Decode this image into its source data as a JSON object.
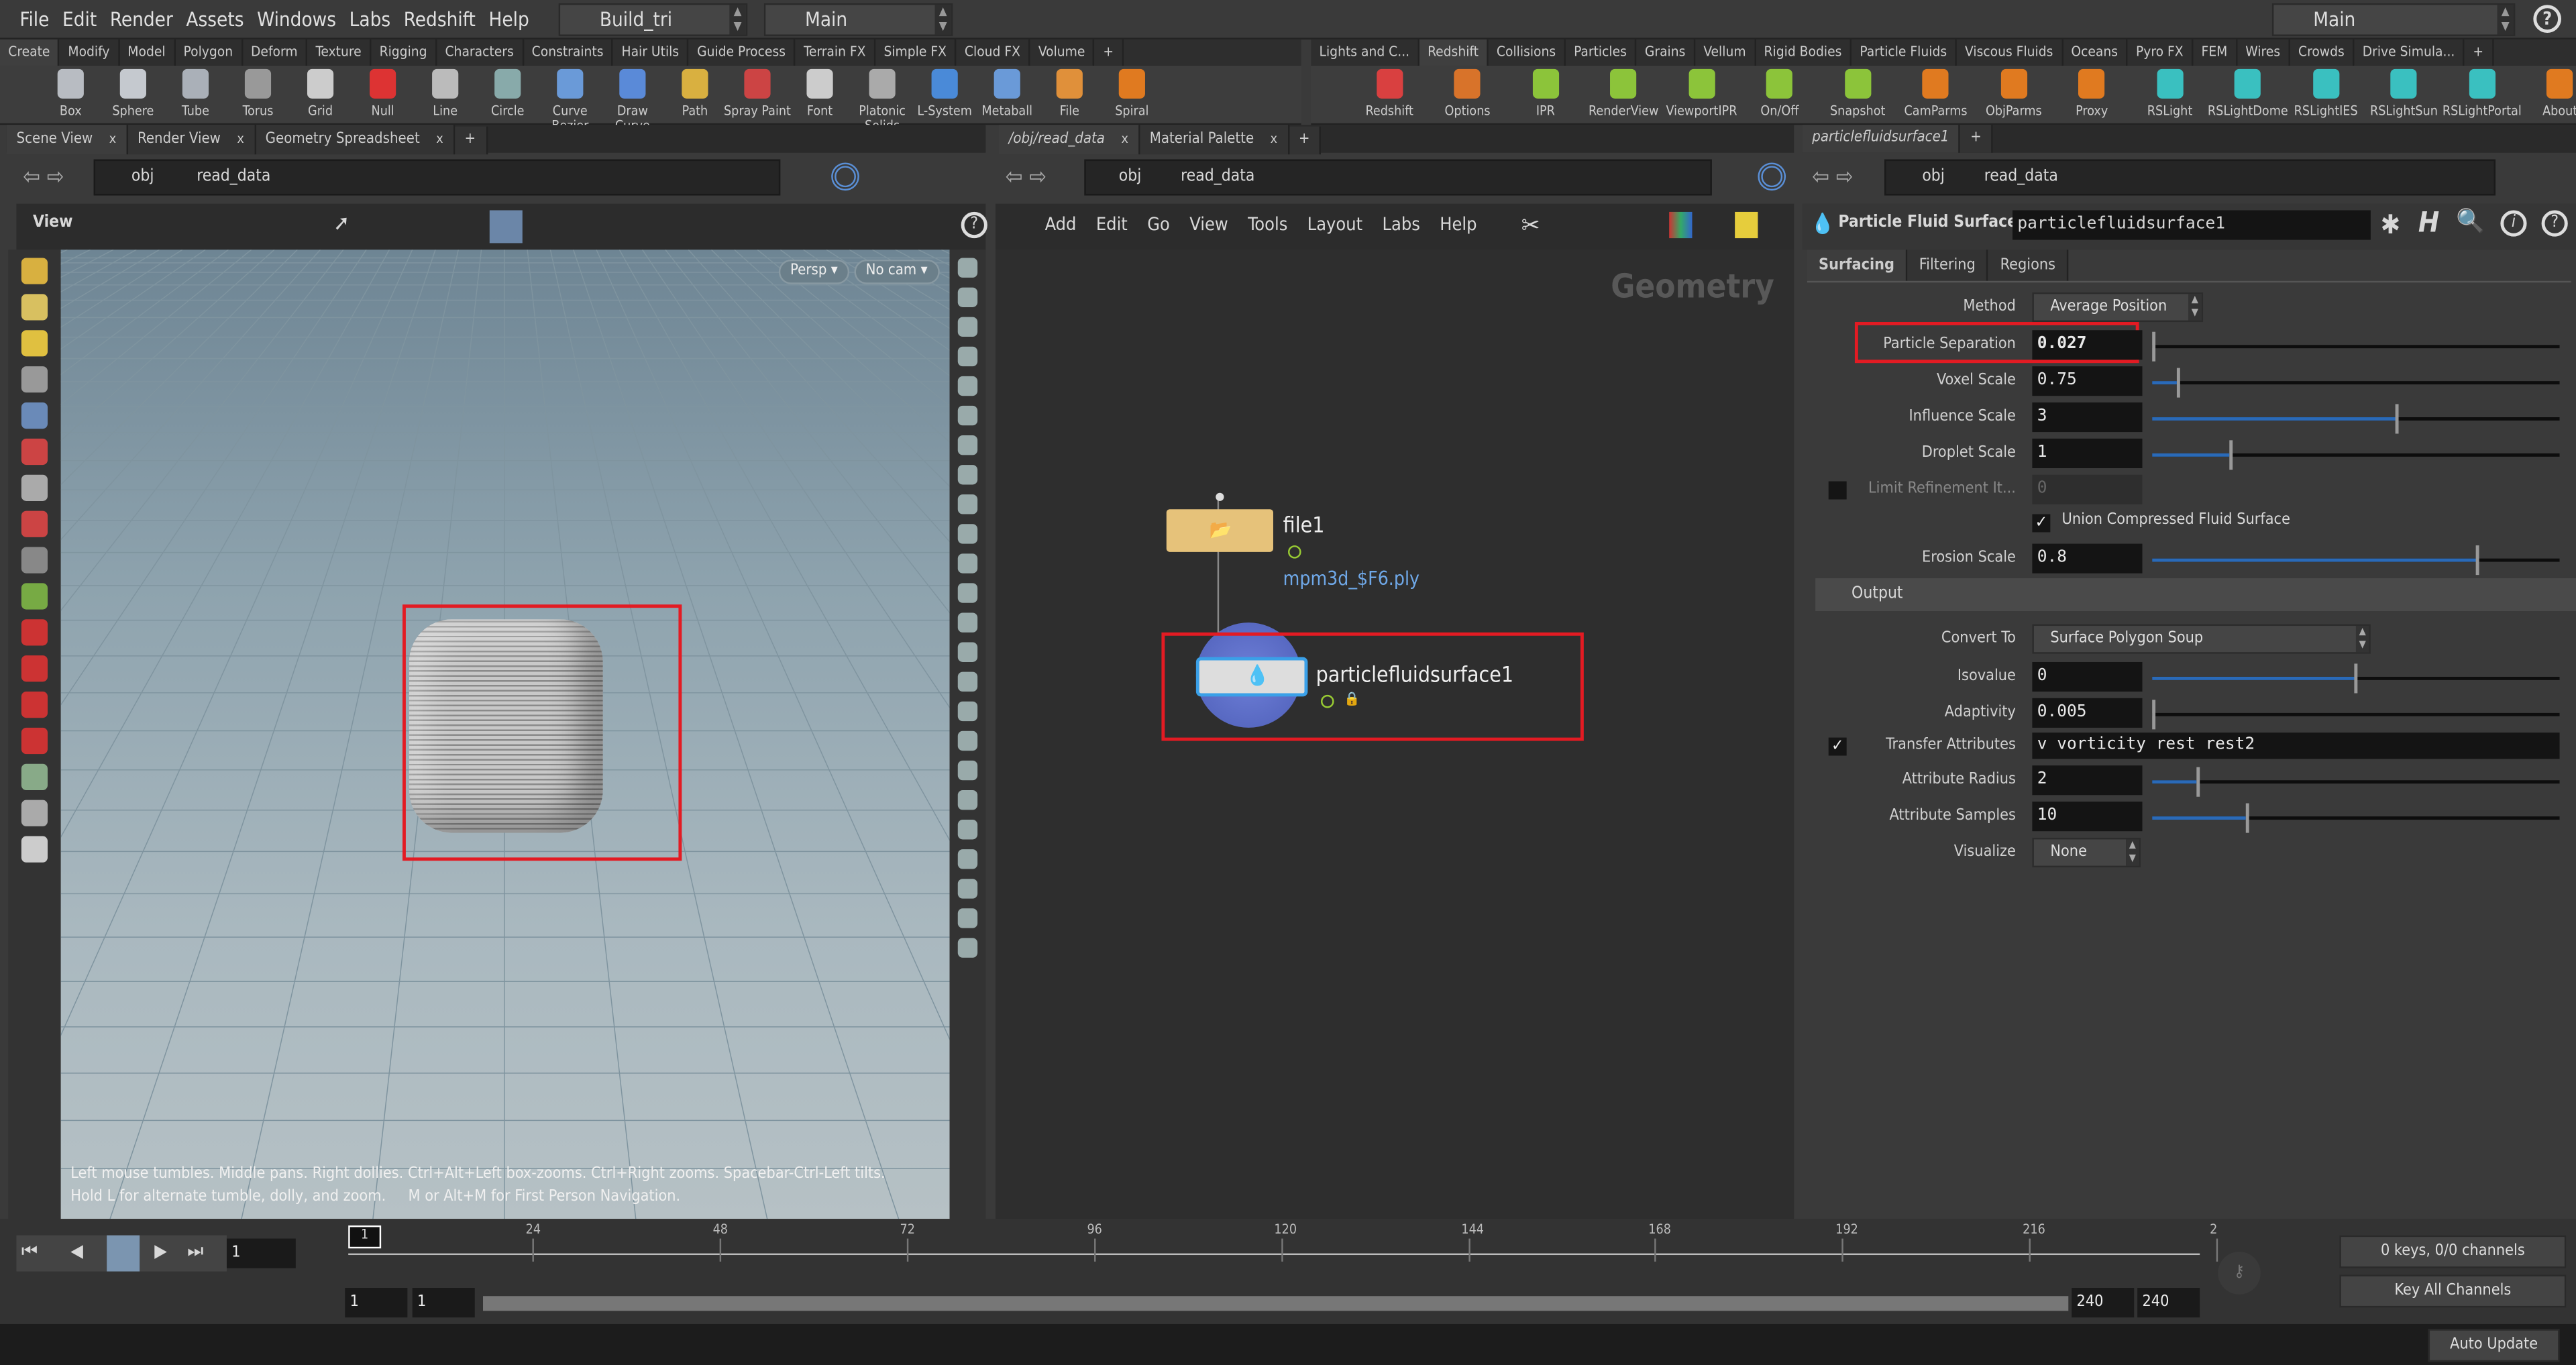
{
  "menubar": {
    "items": [
      "File",
      "Edit",
      "Render",
      "Assets",
      "Windows",
      "Labs",
      "Redshift",
      "Help"
    ],
    "desktop": "Build_tri",
    "context": "Main",
    "right_context": "Main",
    "help_icon": "question-icon"
  },
  "shelf_left": {
    "tabs": [
      "Create",
      "Modify",
      "Model",
      "Polygon",
      "Deform",
      "Texture",
      "Rigging",
      "Characters",
      "Constraints",
      "Hair Utils",
      "Guide Process",
      "Terrain FX",
      "Simple FX",
      "Cloud FX",
      "Volume"
    ],
    "active": "Create",
    "tools": [
      "Box",
      "Sphere",
      "Tube",
      "Torus",
      "Grid",
      "Null",
      "Line",
      "Circle",
      "Curve Bezier",
      "Draw Curve",
      "Path",
      "Spray Paint",
      "Font",
      "Platonic Solids",
      "L-System",
      "Metaball",
      "File",
      "Spiral"
    ]
  },
  "shelf_right": {
    "tabs": [
      "Lights and C...",
      "Redshift",
      "Collisions",
      "Particles",
      "Grains",
      "Vellum",
      "Rigid Bodies",
      "Particle Fluids",
      "Viscous Fluids",
      "Oceans",
      "Pyro FX",
      "FEM",
      "Wires",
      "Crowds",
      "Drive Simula..."
    ],
    "active": "Redshift",
    "tools": [
      "Redshift",
      "Options",
      "IPR",
      "RenderView",
      "ViewportIPR",
      "On/Off",
      "Snapshot",
      "CamParms",
      "ObjParms",
      "Proxy",
      "RSLight",
      "RSLightDome",
      "RSLightIES",
      "RSLightSun",
      "RSLightPortal",
      "About"
    ]
  },
  "scene_pane": {
    "tabs": [
      "Scene View",
      "Render View",
      "Geometry Spreadsheet"
    ],
    "path": [
      "obj",
      "read_data"
    ],
    "toolbar_title": "View",
    "persp": "Persp",
    "cam": "No cam",
    "hint_line1": "Left mouse tumbles. Middle pans. Right dollies. Ctrl+Alt+Left box-zooms. Ctrl+Right zooms. Spacebar-Ctrl-Left tilts.",
    "hint_line2": "Hold L for alternate tumble, dolly, and zoom.     M or Alt+M for First Person Navigation."
  },
  "network_pane": {
    "tabs": [
      "/obj/read_data",
      "Material Palette"
    ],
    "path": [
      "obj",
      "read_data"
    ],
    "menu": [
      "Add",
      "Edit",
      "Go",
      "View",
      "Tools",
      "Layout",
      "Labs",
      "Help"
    ],
    "context_label": "Geometry",
    "nodes": [
      {
        "name": "file1",
        "subtitle": "mpm3d_$F6.ply"
      },
      {
        "name": "particlefluidsurface1"
      }
    ]
  },
  "param_pane": {
    "tab": "particlefluidsurface1",
    "path": [
      "obj",
      "read_data"
    ],
    "node_type": "Particle Fluid Surface",
    "node_name": "particlefluidsurface1",
    "tabs": [
      "Surfacing",
      "Filtering",
      "Regions"
    ],
    "active_tab": "Surfacing",
    "method": {
      "label": "Method",
      "value": "Average Position"
    },
    "sliders": [
      {
        "label": "Particle Separation",
        "value": "0.027",
        "fraction": 0.0
      },
      {
        "label": "Voxel Scale",
        "value": "0.75",
        "fraction": 0.06
      },
      {
        "label": "Influence Scale",
        "value": "3",
        "fraction": 0.6
      },
      {
        "label": "Droplet Scale",
        "value": "1",
        "fraction": 0.19
      }
    ],
    "limit": {
      "label": "Limit Refinement It...",
      "value": "0",
      "checked": false
    },
    "union": {
      "label": "Union Compressed Fluid Surface",
      "checked": true
    },
    "erosion": {
      "label": "Erosion Scale",
      "value": "0.8",
      "fraction": 0.8
    },
    "output_header": "Output",
    "convert": {
      "label": "Convert To",
      "value": "Surface Polygon Soup"
    },
    "out_sliders": [
      {
        "label": "Isovalue",
        "value": "0",
        "fraction": 0.5
      },
      {
        "label": "Adaptivity",
        "value": "0.005",
        "fraction": 0.0
      }
    ],
    "transfer": {
      "label": "Transfer Attributes",
      "value": "v vorticity rest rest2",
      "checked": true
    },
    "out_sliders2": [
      {
        "label": "Attribute Radius",
        "value": "2",
        "fraction": 0.11
      },
      {
        "label": "Attribute Samples",
        "value": "10",
        "fraction": 0.23
      }
    ],
    "visualize": {
      "label": "Visualize",
      "value": "None"
    }
  },
  "timeline": {
    "frame": "1",
    "ticks": [
      "24",
      "48",
      "72",
      "96",
      "120",
      "144",
      "168",
      "192",
      "216",
      "2"
    ],
    "current_marker": "1",
    "range_start": "1",
    "range_start2": "1",
    "range_end": "240",
    "range_end2": "240",
    "keys": "0 keys, 0/0 channels",
    "key_all": "Key All Channels"
  },
  "status": {
    "update_mode": "Auto Update"
  },
  "colors": {
    "highlight": "#e31b23",
    "slider_fill": "#2a6ab8",
    "link": "#6fa8e8"
  }
}
